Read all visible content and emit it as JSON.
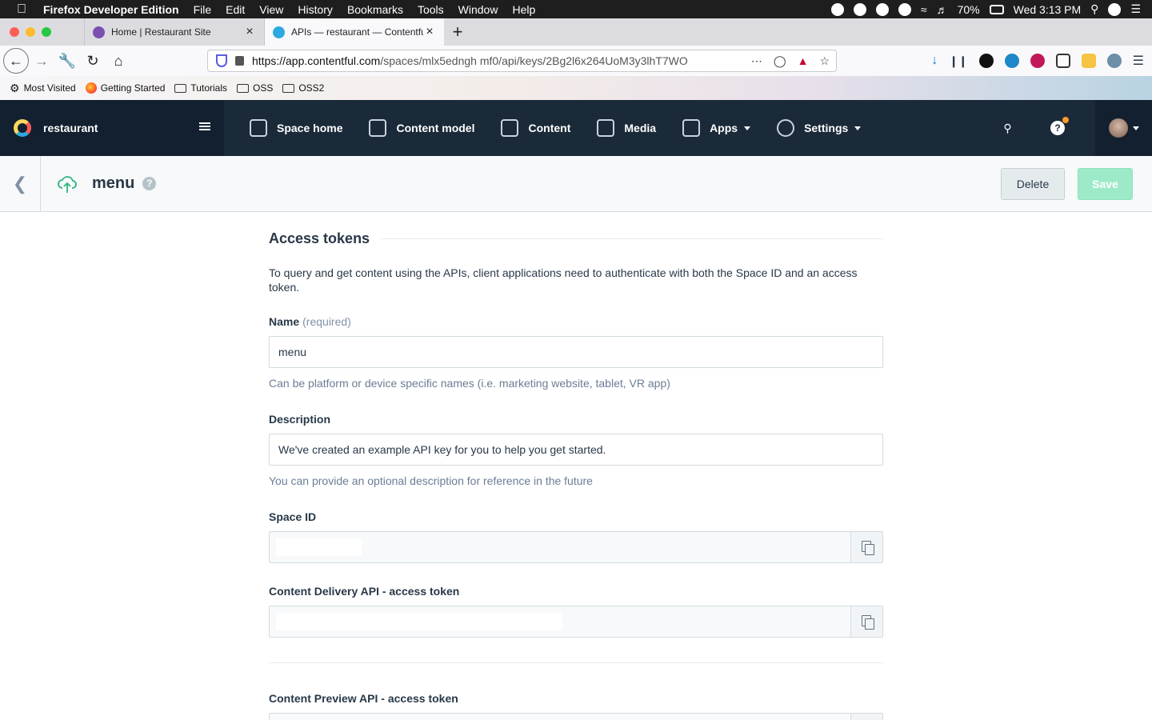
{
  "macos": {
    "app_name": "Firefox Developer Edition",
    "menus": [
      "File",
      "Edit",
      "View",
      "History",
      "Bookmarks",
      "Tools",
      "Window",
      "Help"
    ],
    "battery": "70%",
    "clock": "Wed 3:13 PM"
  },
  "browser": {
    "tabs": [
      {
        "title": "Home | Restaurant Site",
        "favicon_color": "#7b4fb1"
      },
      {
        "title": "APIs — restaurant — Contentful",
        "favicon_color": "#2ba9e0"
      }
    ],
    "url_host": "https://app.contentful.com",
    "url_path": "/spaces/mlx5edngh mf0/api/keys/2Bg2l6x264UoM3y3lhT7WO",
    "bookmarks": [
      "Most Visited",
      "Getting Started",
      "Tutorials",
      "OSS",
      "OSS2"
    ]
  },
  "cf_nav": {
    "space_name": "restaurant",
    "links": [
      {
        "label": "Space home",
        "icon": "home-icon",
        "caret": false
      },
      {
        "label": "Content model",
        "icon": "cube-icon",
        "caret": false
      },
      {
        "label": "Content",
        "icon": "edit-icon",
        "caret": false
      },
      {
        "label": "Media",
        "icon": "image-icon",
        "caret": false
      },
      {
        "label": "Apps",
        "icon": "puzzle-icon",
        "caret": true
      },
      {
        "label": "Settings",
        "icon": "gear-icon",
        "caret": true
      }
    ],
    "help": "?"
  },
  "header": {
    "title": "menu",
    "help_mark": "?",
    "delete_label": "Delete",
    "save_label": "Save",
    "accent_save": "#9deac9"
  },
  "form": {
    "section_title": "Access tokens",
    "intro": "To query and get content using the APIs, client applications need to authenticate with both the Space ID and an access token.",
    "name_label": "Name",
    "name_required": "(required)",
    "name_value": "menu",
    "name_hint": "Can be platform or device specific names (i.e. marketing website, tablet, VR app)",
    "description_label": "Description",
    "description_value": "We've created an example API key for you to help you get started.",
    "description_hint": "You can provide an optional description for reference in the future",
    "space_id_label": "Space ID",
    "cda_label": "Content Delivery API - access token",
    "cpa_label": "Content Preview API - access token"
  }
}
